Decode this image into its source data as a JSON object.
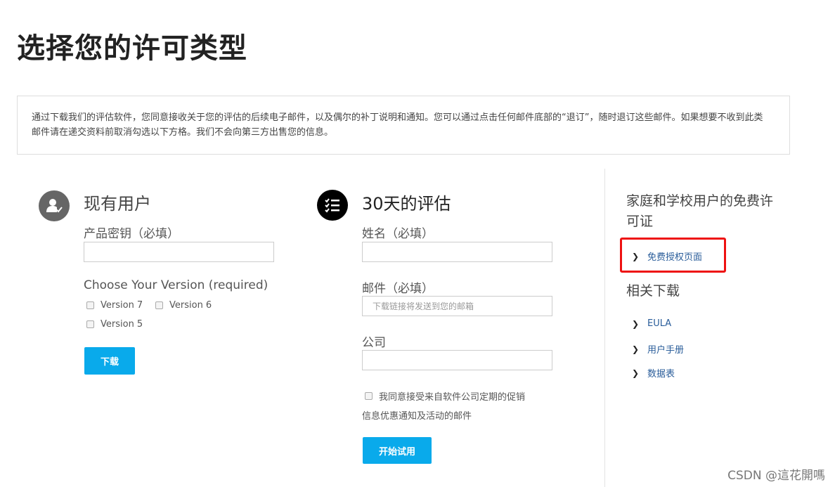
{
  "page": {
    "title": "选择您的许可类型",
    "notice": "通过下载我们的评估软件，您同意接收关于您的评估的后续电子邮件，以及偶尔的补丁说明和通知。您可以通过点击任何邮件底部的“退订”，随时退订这些邮件。如果想要不收到此类邮件请在递交资料前取消勾选以下方格。我们不会向第三方出售您的信息。"
  },
  "existing_user": {
    "icon": "user-check-icon",
    "title": "现有用户",
    "key_label": "产品密钥（必填）",
    "key_value": "",
    "version_label": "Choose Your Version (required)",
    "versions": [
      "Version 7",
      "Version 6",
      "Version 5"
    ],
    "download_button": "下载"
  },
  "trial": {
    "icon": "checklist-icon",
    "title": "30天的评估",
    "name_label": "姓名（必填）",
    "name_value": "",
    "email_label": "邮件（必填）",
    "email_placeholder": "下载链接将发送到您的邮箱",
    "company_label": "公司",
    "company_value": "",
    "consent_line1": "我同意接受来自软件公司定期的促销",
    "consent_line2": "信息优惠通知及活动的邮件",
    "start_button": "开始试用"
  },
  "sidebar": {
    "free_heading_line1": "家庭和学校用户的免费许",
    "free_heading_line2": "可证",
    "free_link": "免费授权页面",
    "downloads_heading": "相关下载",
    "links": [
      "EULA",
      "用户手册",
      "数据表"
    ]
  },
  "highlight_color": "#ee1111",
  "accent_color": "#09aaeb",
  "watermark": "CSDN @這花開嗎"
}
